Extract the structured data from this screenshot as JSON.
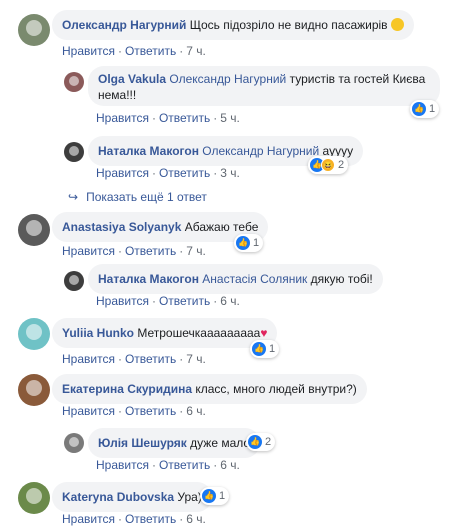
{
  "comments": [
    {
      "author": "Олександр Нагурний",
      "text": "Щось підозріло не видно пасажирів",
      "emoji": "😊",
      "like": "Нравится",
      "reply": "Ответить",
      "time": "7 ч."
    },
    {
      "author": "Olga Vakula",
      "mention": "Олександр Нагурний",
      "text": "туристів та гостей Києва нема!!!",
      "like": "Нравится",
      "reply": "Ответить",
      "time": "5 ч.",
      "reactions": {
        "count": "1"
      }
    },
    {
      "author": "Наталка Макогон",
      "mention": "Олександр Нагурний",
      "text": "аyyyy",
      "like": "Нравится",
      "reply": "Ответить",
      "time": "3 ч.",
      "reactions": {
        "count": "2"
      }
    },
    {
      "author": "Anastasiya Solyanyk",
      "text": "Абажаю тебе",
      "like": "Нравится",
      "reply": "Ответить",
      "time": "7 ч.",
      "reactions": {
        "count": "1"
      }
    },
    {
      "author": "Наталка Макогон",
      "mention": "Анастасія Соляник",
      "text": "дякую тобі!",
      "like": "Нравится",
      "reply": "Ответить",
      "time": "6 ч."
    },
    {
      "author": "Yuliia Hunko",
      "text": "Метрошечкааааааааа",
      "emoji": "❤️",
      "like": "Нравится",
      "reply": "Ответить",
      "time": "7 ч.",
      "reactions": {
        "count": "1"
      }
    },
    {
      "author": "Екатерина Скуридина",
      "text": "класс, много людей внутри?)",
      "like": "Нравится",
      "reply": "Ответить",
      "time": "6 ч."
    },
    {
      "author": "Юлія Шешуряк",
      "text": "дуже мало",
      "like": "Нравится",
      "reply": "Ответить",
      "time": "6 ч.",
      "reactions": {
        "count": "2"
      }
    },
    {
      "author": "Kateryna Dubovska",
      "text": "Ура)",
      "like": "Нравится",
      "reply": "Ответить",
      "time": "6 ч.",
      "reactions": {
        "count": "1"
      }
    }
  ],
  "show_more": "Показать ещё 1 ответ",
  "colors": {
    "link": "#385898",
    "bubble": "#f2f3f5",
    "meta": "#606770",
    "like": "#1877f2"
  }
}
